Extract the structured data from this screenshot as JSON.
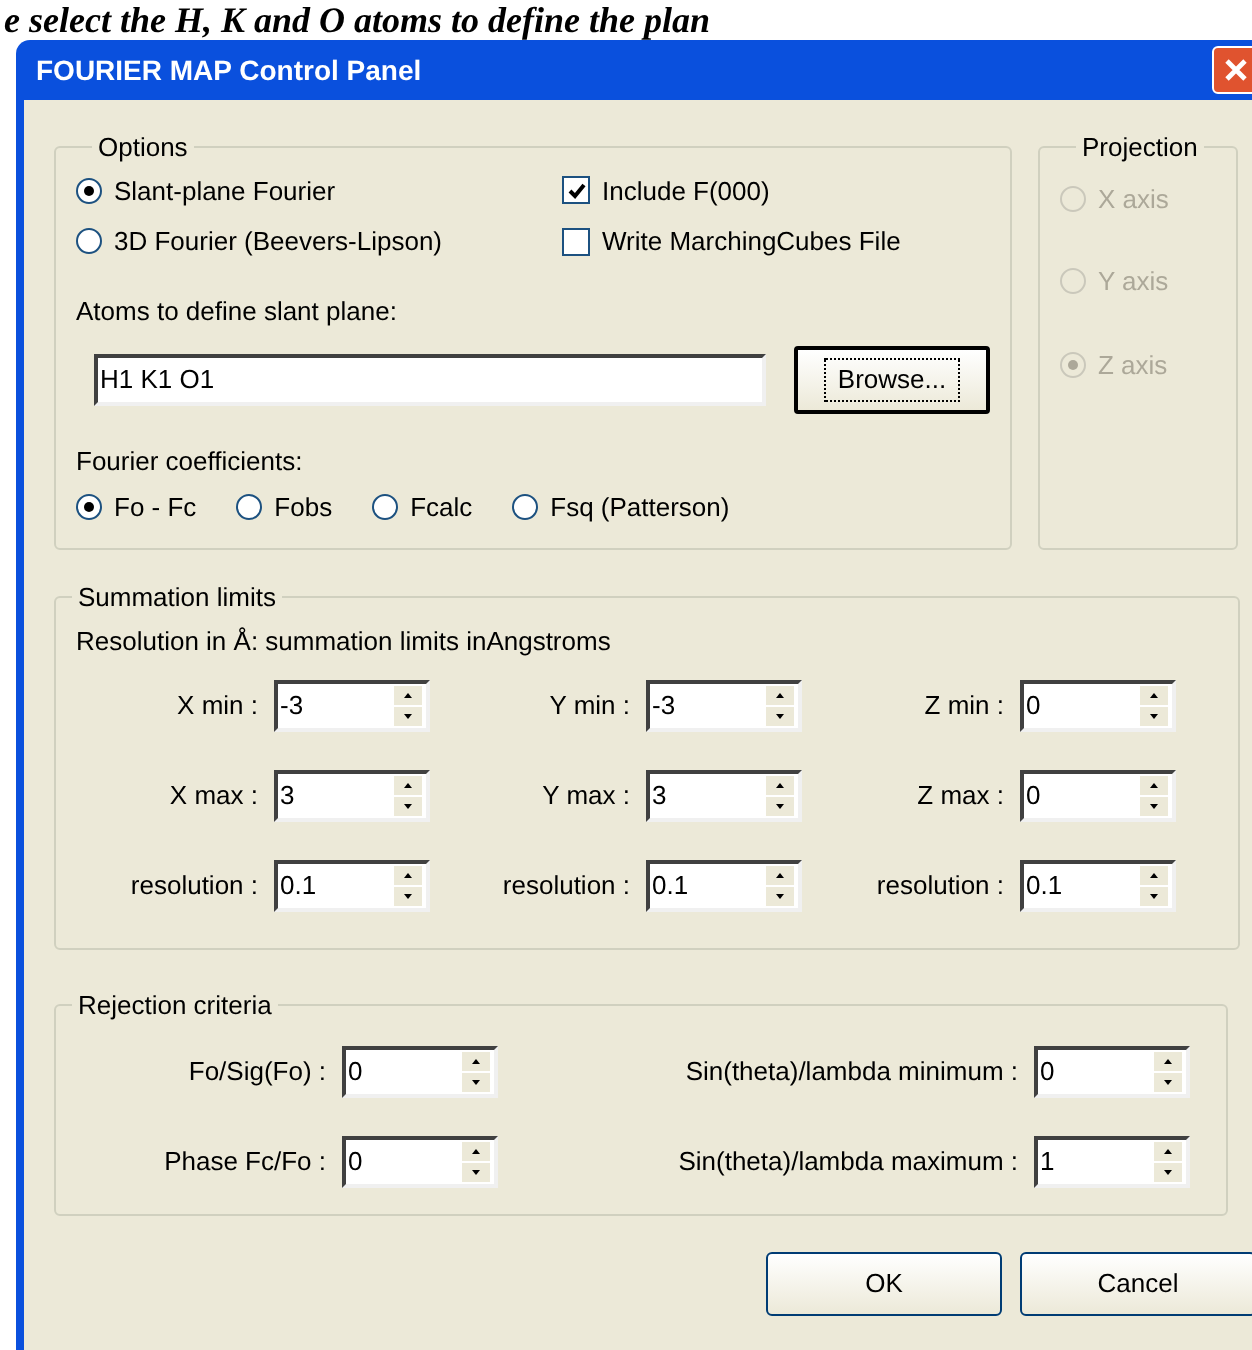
{
  "caption": "e select the H, K and O atoms to define the plan",
  "window": {
    "title": "FOURIER MAP Control Panel"
  },
  "options": {
    "label": "Options",
    "modes": [
      {
        "label": "Slant-plane Fourier",
        "selected": true
      },
      {
        "label": "3D Fourier (Beevers-Lipson)",
        "selected": false
      }
    ],
    "checks": [
      {
        "label": "Include F(000)",
        "checked": true
      },
      {
        "label": "Write MarchingCubes File",
        "checked": false
      }
    ],
    "atoms_label": "Atoms to define slant plane:",
    "atoms_value": "H1 K1 O1",
    "browse": {
      "label": "Browse...",
      "focused": true
    },
    "coeff_label": "Fourier coefficients:",
    "coefficients": [
      {
        "label": "Fo - Fc",
        "selected": true
      },
      {
        "label": "Fobs",
        "selected": false
      },
      {
        "label": "Fcalc",
        "selected": false
      },
      {
        "label": "Fsq (Patterson)",
        "selected": false
      }
    ]
  },
  "projection": {
    "label": "Projection",
    "disabled": true,
    "axes": [
      {
        "label": "X axis",
        "selected": false
      },
      {
        "label": "Y axis",
        "selected": false
      },
      {
        "label": "Z axis",
        "selected": true
      }
    ]
  },
  "summation": {
    "label": "Summation limits",
    "note": "Resolution in Å: summation limits inAngstroms",
    "rows": [
      [
        {
          "label": "X min :",
          "value": "-3"
        },
        {
          "label": "Y min :",
          "value": "-3"
        },
        {
          "label": "Z min :",
          "value": "0"
        }
      ],
      [
        {
          "label": "X max :",
          "value": "3"
        },
        {
          "label": "Y max :",
          "value": "3"
        },
        {
          "label": "Z max :",
          "value": "0"
        }
      ],
      [
        {
          "label": "resolution :",
          "value": "0.1"
        },
        {
          "label": "resolution :",
          "value": "0.1"
        },
        {
          "label": "resolution :",
          "value": "0.1"
        }
      ]
    ]
  },
  "rejection": {
    "label": "Rejection criteria",
    "fields": [
      {
        "label": "Fo/Sig(Fo) :",
        "value": "0"
      },
      {
        "label": "Sin(theta)/lambda minimum :",
        "value": "0"
      },
      {
        "label": "Phase Fc/Fo :",
        "value": "0"
      },
      {
        "label": "Sin(theta)/lambda maximum :",
        "value": "1"
      }
    ]
  },
  "buttons": [
    {
      "label": "OK",
      "focused": false
    },
    {
      "label": "Cancel",
      "focused": false
    }
  ]
}
